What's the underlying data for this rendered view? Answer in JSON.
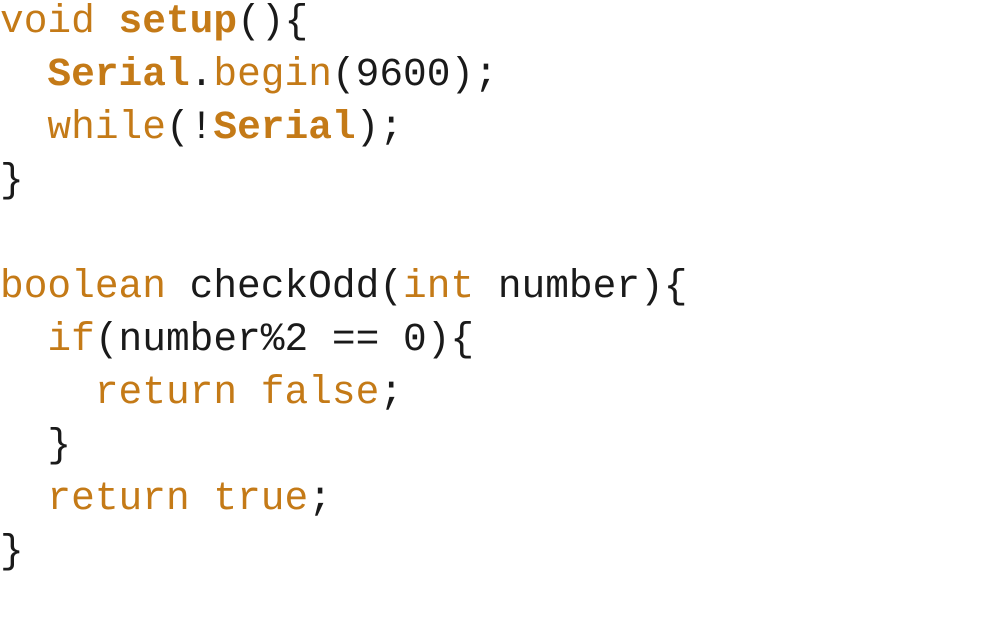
{
  "code": {
    "lines": [
      [
        {
          "text": "void",
          "kind": "kw"
        },
        {
          "text": " ",
          "kind": "plain"
        },
        {
          "text": "setup",
          "kind": "fn-bold"
        },
        {
          "text": "(){",
          "kind": "plain"
        }
      ],
      [
        {
          "text": "  ",
          "kind": "plain"
        },
        {
          "text": "Serial",
          "kind": "fn-bold"
        },
        {
          "text": ".",
          "kind": "plain"
        },
        {
          "text": "begin",
          "kind": "kw"
        },
        {
          "text": "(9600);",
          "kind": "plain"
        }
      ],
      [
        {
          "text": "  ",
          "kind": "plain"
        },
        {
          "text": "while",
          "kind": "kw"
        },
        {
          "text": "(!",
          "kind": "plain"
        },
        {
          "text": "Serial",
          "kind": "fn-bold"
        },
        {
          "text": ");",
          "kind": "plain"
        }
      ],
      [
        {
          "text": "}",
          "kind": "plain"
        }
      ],
      [],
      [
        {
          "text": "boolean",
          "kind": "kw"
        },
        {
          "text": " checkOdd(",
          "kind": "plain"
        },
        {
          "text": "int",
          "kind": "kw"
        },
        {
          "text": " number){",
          "kind": "plain"
        }
      ],
      [
        {
          "text": "  ",
          "kind": "plain"
        },
        {
          "text": "if",
          "kind": "kw"
        },
        {
          "text": "(number%2 == 0){",
          "kind": "plain"
        }
      ],
      [
        {
          "text": "    ",
          "kind": "plain"
        },
        {
          "text": "return",
          "kind": "kw"
        },
        {
          "text": " ",
          "kind": "plain"
        },
        {
          "text": "false",
          "kind": "kw"
        },
        {
          "text": ";",
          "kind": "plain"
        }
      ],
      [
        {
          "text": "  }",
          "kind": "plain"
        }
      ],
      [
        {
          "text": "  ",
          "kind": "plain"
        },
        {
          "text": "return",
          "kind": "kw"
        },
        {
          "text": " ",
          "kind": "plain"
        },
        {
          "text": "true",
          "kind": "kw"
        },
        {
          "text": ";",
          "kind": "plain"
        }
      ],
      [
        {
          "text": "}",
          "kind": "plain"
        }
      ]
    ]
  },
  "colors": {
    "keyword": "#c47a17",
    "text": "#1a1a1a",
    "background": "#ffffff"
  }
}
